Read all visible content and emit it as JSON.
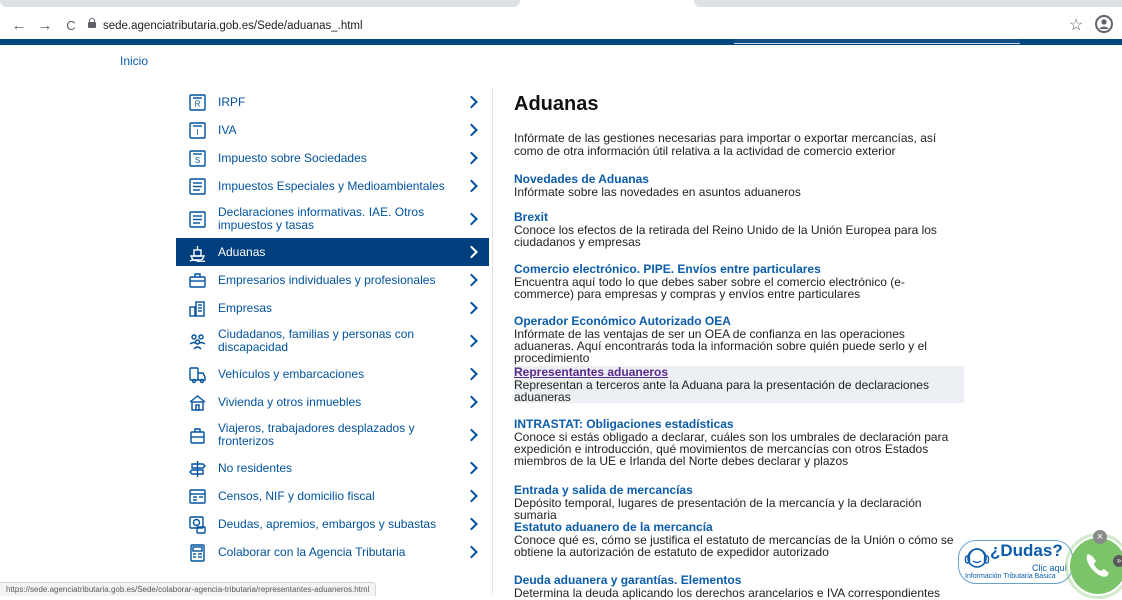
{
  "browser": {
    "url": "sede.agenciatributaria.gob.es/Sede/aduanas_.html",
    "back_icon": "←",
    "forward_icon": "→",
    "reload_icon": "C",
    "star_icon": "☆"
  },
  "breadcrumb": "Inicio",
  "menu": [
    {
      "icon": "irpf-icon",
      "label": "IRPF",
      "active": false
    },
    {
      "icon": "iva-icon",
      "label": "IVA",
      "active": false
    },
    {
      "icon": "sociedades-icon",
      "label": "Impuesto sobre Sociedades",
      "active": false
    },
    {
      "icon": "impuestos-especiales-icon",
      "label": "Impuestos Especiales y Medioambientales",
      "active": false
    },
    {
      "icon": "declaraciones-icon",
      "label": "Declaraciones informativas. IAE. Otros impuestos y tasas",
      "active": false
    },
    {
      "icon": "aduanas-icon",
      "label": "Aduanas",
      "active": true
    },
    {
      "icon": "empresarios-icon",
      "label": "Empresarios individuales y profesionales",
      "active": false
    },
    {
      "icon": "empresas-icon",
      "label": "Empresas",
      "active": false
    },
    {
      "icon": "ciudadanos-icon",
      "label": "Ciudadanos, familias y personas con discapacidad",
      "active": false
    },
    {
      "icon": "vehiculos-icon",
      "label": "Vehículos y embarcaciones",
      "active": false
    },
    {
      "icon": "vivienda-icon",
      "label": "Vivienda y otros inmuebles",
      "active": false
    },
    {
      "icon": "viajeros-icon",
      "label": "Viajeros, trabajadores desplazados y fronterizos",
      "active": false
    },
    {
      "icon": "no-residentes-icon",
      "label": "No residentes",
      "active": false
    },
    {
      "icon": "censos-icon",
      "label": "Censos, NIF y domicilio fiscal",
      "active": false
    },
    {
      "icon": "deudas-icon",
      "label": "Deudas, apremios, embargos y subastas",
      "active": false
    },
    {
      "icon": "colaborar-icon",
      "label": "Colaborar con la Agencia Tributaria",
      "active": false
    }
  ],
  "main": {
    "title": "Aduanas",
    "intro": "Infórmate de las gestiones necesarias para importar o exportar mercancías, así como de otra información útil relativa a la actividad de comercio exterior",
    "entries": [
      {
        "title": "Novedades de Aduanas",
        "desc": "Infórmate sobre las novedades en asuntos aduaneros"
      },
      {
        "title": "Brexit",
        "desc": "Conoce los efectos de la retirada del Reino Unido de la Unión Europea para los ciudadanos y empresas"
      },
      {
        "title": "Comercio electrónico. PIPE. Envíos entre particulares",
        "desc": "Encuentra aquí todo lo que debes saber sobre el comercio electrónico (e-commerce) para empresas y compras y envíos entre particulares"
      },
      {
        "title": "Operador Económico Autorizado OEA",
        "desc": "Infórmate de las ventajas de ser un OEA de confianza en las operaciones aduaneras. Aquí encontrarás toda la información sobre quién puede serlo y el procedimiento"
      },
      {
        "title": "Representantes aduaneros",
        "desc": "Representan a terceros ante la Aduana para la presentación de declaraciones aduaneras"
      },
      {
        "title": "INTRASTAT: Obligaciones estadísticas",
        "desc": "Conoce si estás obligado a declarar, cuáles son los umbrales de declaración para expedición e introducción, qué movimientos de mercancías con otros Estados miembros de la UE e Irlanda del Norte debes declarar y plazos"
      },
      {
        "title": "Entrada y salida de mercancías",
        "desc": "Depósito temporal, lugares de presentación de la mercancía y la declaración sumaria"
      },
      {
        "title": "Estatuto aduanero de la mercancía",
        "desc": "Conoce qué es, cómo se justifica el estatuto de mercancías de la Unión o cómo se obtiene la autorización de estatuto de expedidor autorizado"
      },
      {
        "title": "Deuda aduanera y garantías. Elementos",
        "desc": "Determina la deuda aplicando los derechos arancelarios e IVA correspondientes"
      }
    ]
  },
  "status_bar": "https://sede.agenciatributaria.gob.es/Sede/colaborar-agencia-tributaria/representantes-aduaneros.html",
  "help_widget": {
    "question": "¿Dudas?",
    "cta": "Clic aquí",
    "subtitle": "Información Tributaria Básica",
    "close": "×",
    "more": "»"
  },
  "colors": {
    "brand_blue": "#00467f",
    "link_blue": "#0b5cab",
    "active_menu": "#003f7d",
    "visited_link": "#5b2a8c"
  }
}
